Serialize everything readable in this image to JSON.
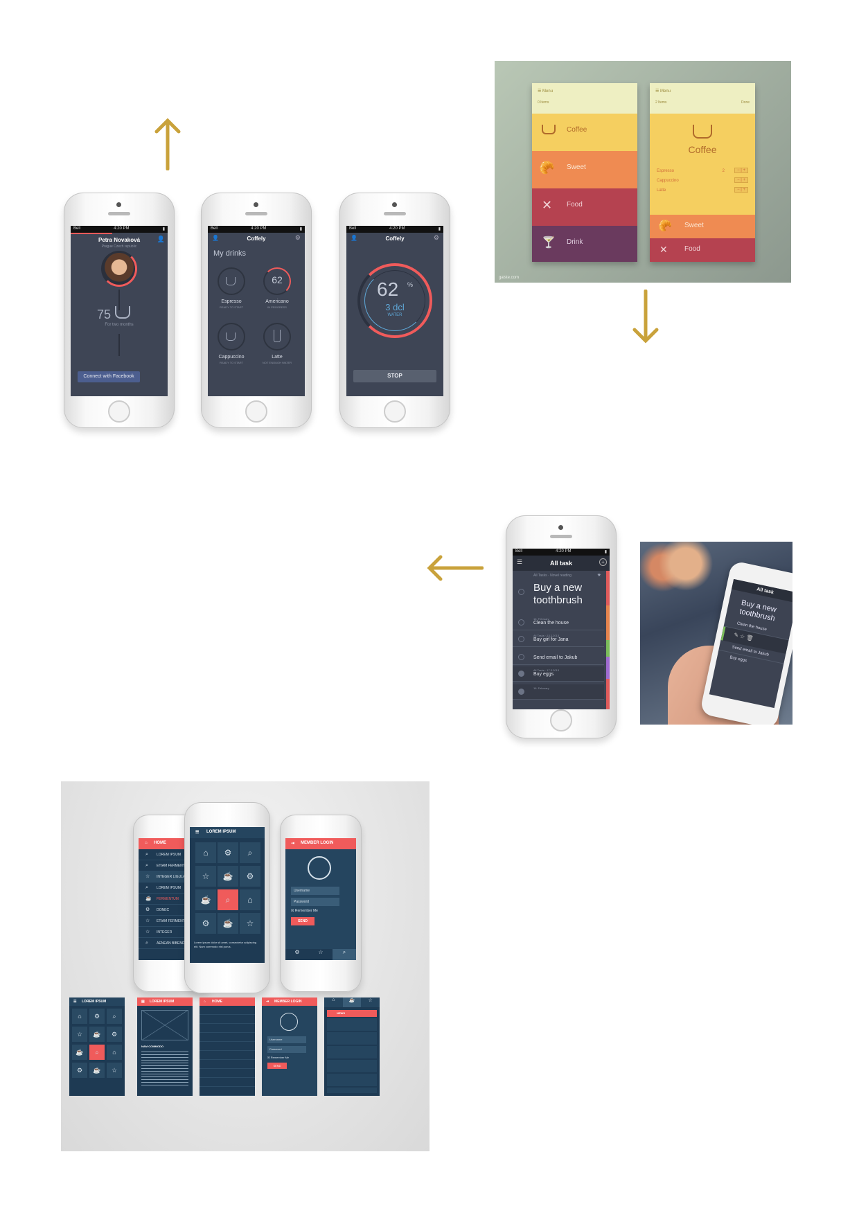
{
  "row1": {
    "phone1": {
      "status": {
        "carrier": "Bell",
        "time": "4:20 PM"
      },
      "name": "Petra Novaková",
      "location": "Prague Czech republic",
      "count": "75",
      "duration": "For two months",
      "button": "Connect with Facebook"
    },
    "phone2": {
      "status": {
        "carrier": "Bell",
        "time": "4:20 PM"
      },
      "title": "Coffely",
      "heading": "My drinks",
      "drinks": [
        {
          "name": "Espresso",
          "sub": "READY TO START"
        },
        {
          "name": "Americano",
          "sub": "IN PROGRESS",
          "value": "62"
        },
        {
          "name": "Cappuccino",
          "sub": "READY TO START"
        },
        {
          "name": "Latte",
          "sub": "NOT ENOUGH WATER"
        }
      ]
    },
    "phone3": {
      "status": {
        "carrier": "Bell",
        "time": "4:20 PM"
      },
      "title": "Coffely",
      "percent": "62",
      "percent_sign": "%",
      "amount": "3 dcl",
      "liquid": "WATER",
      "button": "STOP"
    },
    "cards": {
      "left": {
        "menu": "Menu",
        "count": "0 Items",
        "items": [
          {
            "label": "Coffee",
            "color": "#f5cf60"
          },
          {
            "label": "Sweet",
            "color": "#ef8b52"
          },
          {
            "label": "Food",
            "color": "#b54250"
          },
          {
            "label": "Drink",
            "color": "#6a3a5e"
          }
        ]
      },
      "right": {
        "menu": "Menu",
        "count": "2 Items",
        "done": "Done",
        "title": "Coffee",
        "options": [
          {
            "label": "Espresso",
            "qty": "2"
          },
          {
            "label": "Cappuccino",
            "qty": ""
          },
          {
            "label": "Latte",
            "qty": ""
          }
        ],
        "items": [
          {
            "label": "Sweet",
            "color": "#ef8b52"
          },
          {
            "label": "Food",
            "color": "#b54250"
          }
        ]
      },
      "credit": "gaiste.com"
    }
  },
  "row2": {
    "phone": {
      "status": {
        "carrier": "Bell",
        "time": "4:20 PM"
      },
      "title": "All task",
      "featured_meta": "All Tasks · Novel reading",
      "featured": "Buy a new toothbrush",
      "tasks": [
        {
          "meta": "16. February",
          "label": "Clean the house"
        },
        {
          "meta": "All Tasks · 13.2.2013",
          "label": "Buy girl for Jana"
        },
        {
          "meta": "",
          "label": "Send email to Jakub"
        },
        {
          "meta": "All Tasks · 17.3.2013",
          "label": "Buy eggs"
        },
        {
          "meta": "16. February",
          "label": ""
        }
      ]
    },
    "photo": {
      "title": "All task",
      "featured": "Buy a new toothbrush",
      "tasks": [
        "Clean the house",
        "Send email to Jakub",
        "Buy eggs"
      ]
    }
  },
  "row3": {
    "left": {
      "header": "HOME",
      "items": [
        "LOREM IPSUM",
        "ETIAM FERMENTUM",
        "INTEGER LIGULA",
        "LOREM IPSUM",
        "FERMENTUM",
        "DONEC",
        "ETIAM FERMENTUM",
        "INTEGER",
        "AENEAN BIBENDUM"
      ]
    },
    "center": {
      "header": "LOREM IPSUM",
      "tiles": [
        "⌂",
        "⚙",
        "⌕",
        "☆",
        "☕",
        "⚙",
        "☕",
        "⌕",
        "⌂",
        "⚙",
        "☕",
        "☆"
      ],
      "text": "Lorem ipsum dolor sit amet, consectetur adipiscing elit. Nam commodo nisl purus."
    },
    "right": {
      "header": "MEMBER LOGIN",
      "username": "Username",
      "password": "Password",
      "remember": "Remember Me",
      "send": "SEND"
    },
    "screens": {
      "s1": {
        "header": "LOREM IPSUM"
      },
      "s2": {
        "header": "LOREM IPSUM",
        "subtitle": "NAM COMMODO"
      },
      "s3": {
        "header": "HOME"
      },
      "s4": {
        "header": "MEMBER LOGIN",
        "username": "Username",
        "password": "Password",
        "remember": "Remember Me",
        "send": "SEND"
      },
      "s5": {
        "header": "NEWS"
      }
    }
  },
  "colors": {
    "accent": "#c9a23b",
    "red": "#f05b5b",
    "navy": "#1e3a53",
    "slate": "#3e4555"
  }
}
